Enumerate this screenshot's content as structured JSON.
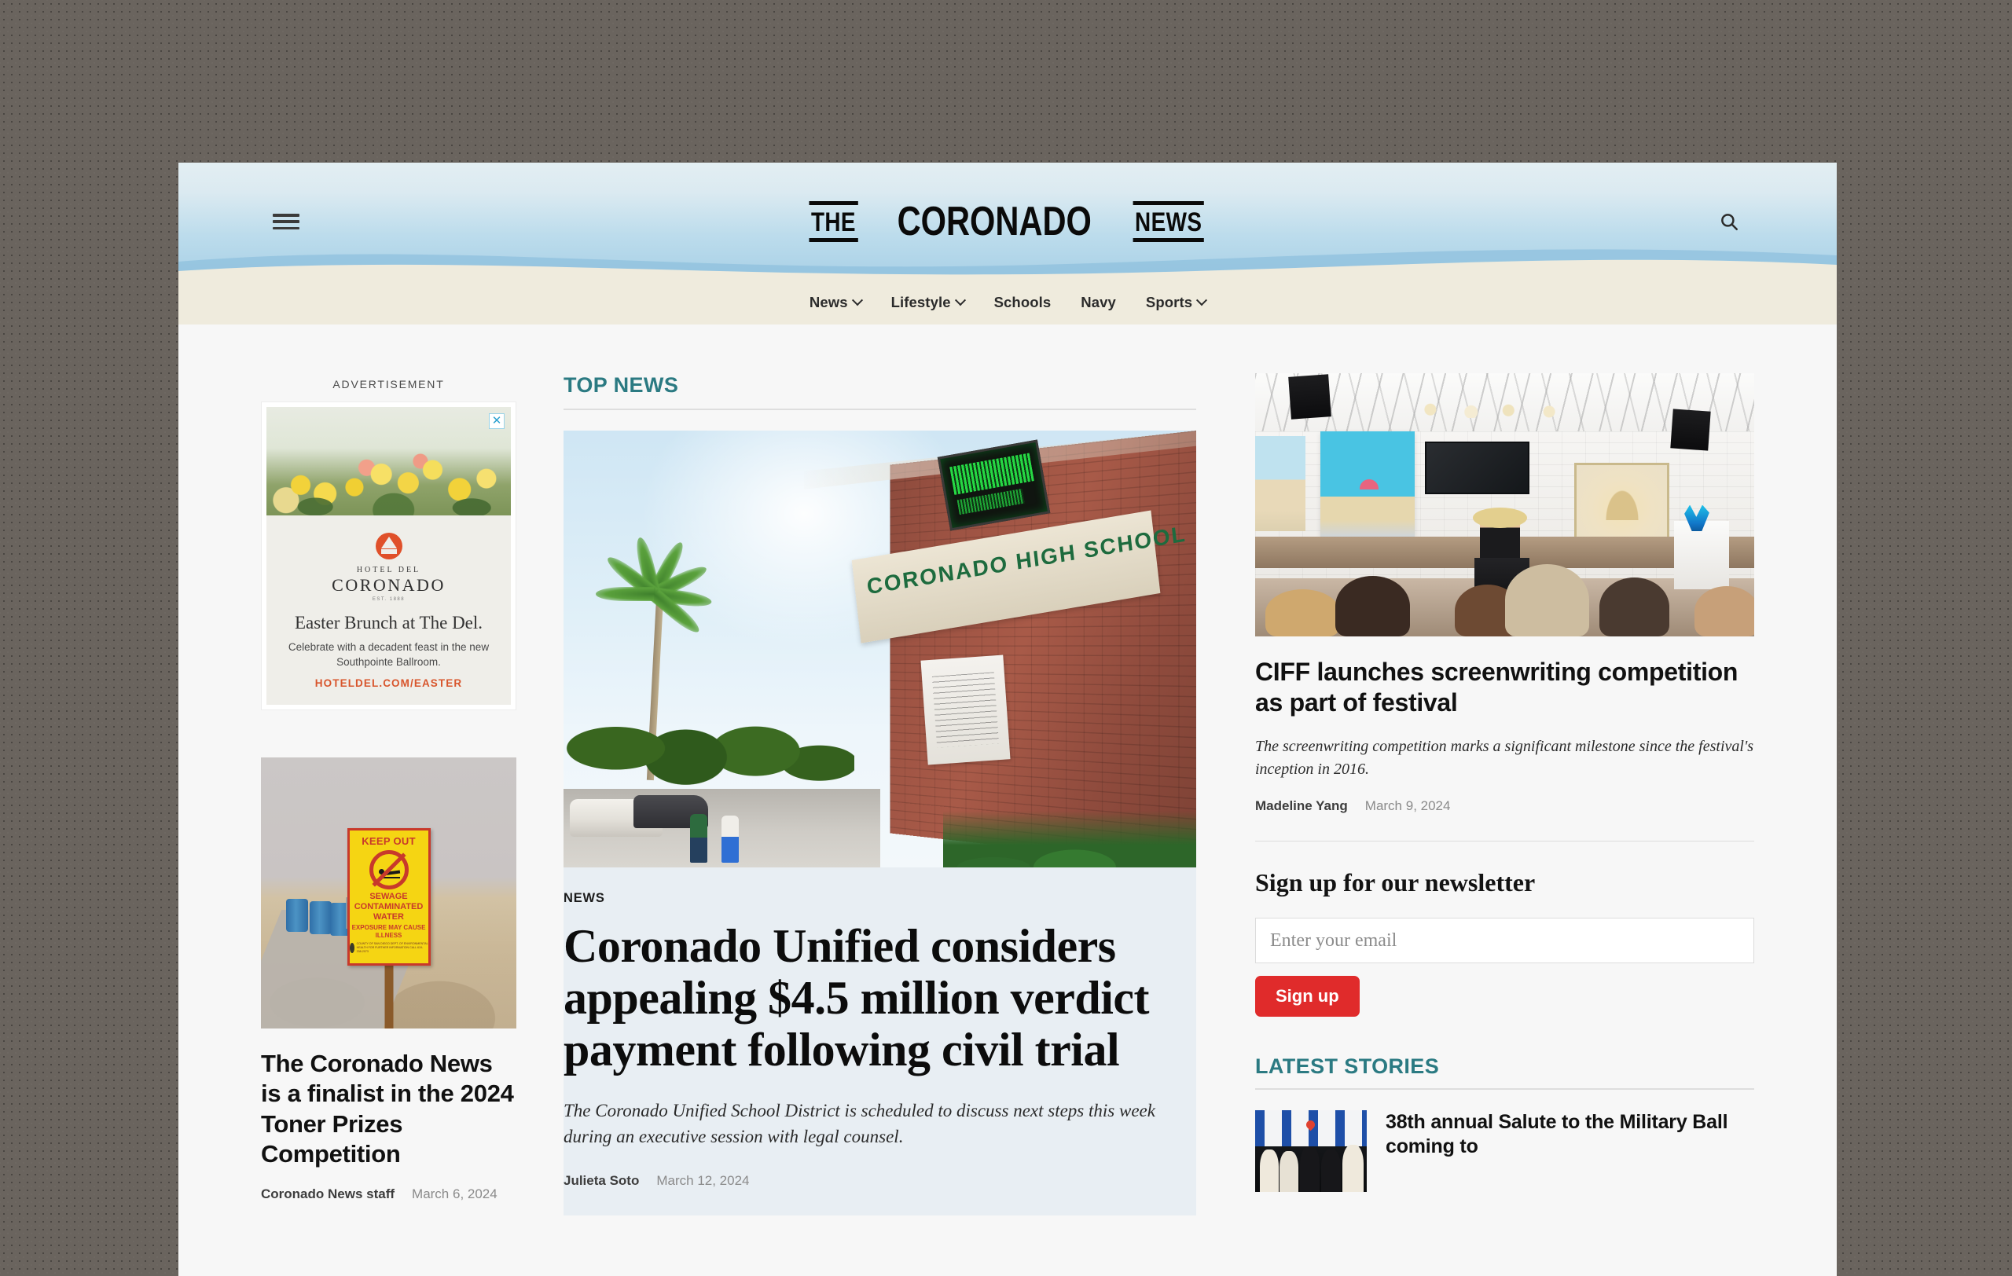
{
  "site": {
    "logo_the": "THE",
    "logo_main": "CORONADO",
    "logo_news": "NEWS",
    "menu_icon": "hamburger-icon",
    "search_icon": "search-icon"
  },
  "nav": {
    "items": [
      {
        "label": "News",
        "has_dropdown": true
      },
      {
        "label": "Lifestyle",
        "has_dropdown": true
      },
      {
        "label": "Schools",
        "has_dropdown": false
      },
      {
        "label": "Navy",
        "has_dropdown": false
      },
      {
        "label": "Sports",
        "has_dropdown": true
      }
    ]
  },
  "left_column": {
    "ad": {
      "label": "ADVERTISEMENT",
      "close_icon": "close-icon",
      "brand_small": "HOTEL DEL",
      "brand_big": "CORONADO",
      "brand_est": "EST. 1888",
      "headline": "Easter Brunch at The Del.",
      "subline": "Celebrate with a decadent feast in the new Southpointe Ballroom.",
      "url": "HOTELDEL.COM/EASTER"
    },
    "story": {
      "image_alt": "KEEP OUT sewage contaminated water beach sign",
      "sign": {
        "title": "KEEP OUT",
        "line1": "SEWAGE CONTAMINATED WATER",
        "line2": "EXPOSURE MAY CAUSE ILLNESS",
        "fine_print": "COUNTY OF SAN DIEGO DEPT. OF ENVIRONMENTAL HEALTH FOR FURTHER INFORMATION CALL 619-338-2073"
      },
      "title": "The Coronado News is a finalist in the 2024 Toner Prizes Competition",
      "author": "Coronado News staff",
      "date": "March 6, 2024"
    }
  },
  "main": {
    "section_label": "TOP NEWS",
    "hero": {
      "image_alt": "Coronado High School brick building exterior with palm trees",
      "image_sign_text": "CORONADO HIGH SCHOOL",
      "kicker": "NEWS",
      "headline": "Coronado Unified considers appealing $4.5 million verdict payment following civil trial",
      "dek": "The Coronado Unified School District is scheduled to discuss next steps this week during an executive session with legal counsel.",
      "author": "Julieta Soto",
      "date": "March 12, 2024"
    }
  },
  "right_column": {
    "feature": {
      "image_alt": "Art gallery audience watching a speaker at a podium",
      "title": "CIFF launches screenwriting competition as part of festival",
      "dek": "The screenwriting competition marks a significant milestone since the festival's inception in 2016.",
      "author": "Madeline Yang",
      "date": "March 9, 2024"
    },
    "newsletter": {
      "heading": "Sign up for our newsletter",
      "email_placeholder": "Enter your email",
      "email_value": "",
      "button_label": "Sign up"
    },
    "latest": {
      "section_label": "LATEST STORIES",
      "items": [
        {
          "image_alt": "Five men in military dress uniforms and tuxedos at a step-and-repeat banner",
          "title": "38th annual Salute to the Military Ball coming to"
        }
      ]
    }
  },
  "colors": {
    "accent_teal": "#2b7a82",
    "signup_red": "#e02b2b",
    "nav_sand": "#efebdd",
    "header_sky": "#a8d0e6",
    "ad_url_orange": "#d8552c"
  }
}
